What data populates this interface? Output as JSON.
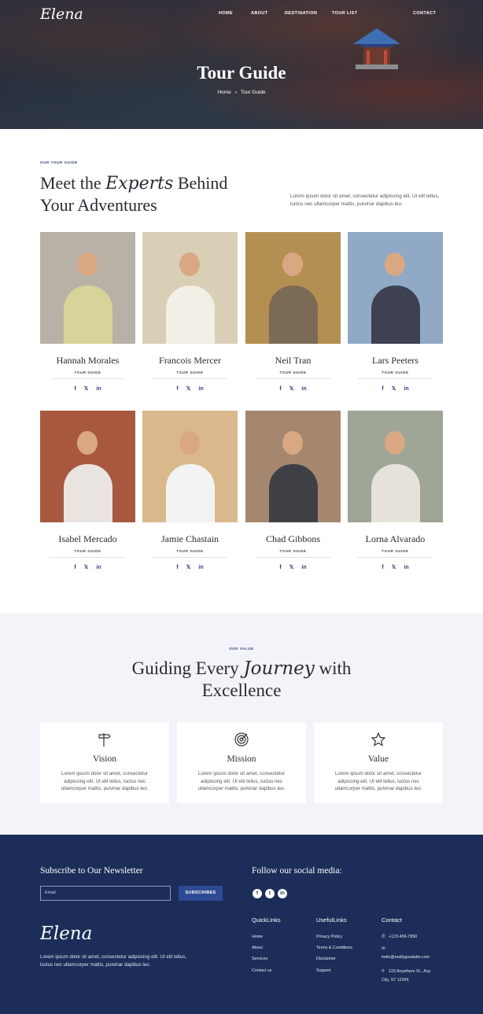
{
  "brand": "Elena",
  "nav": [
    "HOME",
    "ABOUT",
    "DESTINATION",
    "TOUR LIST",
    "CONTACT"
  ],
  "hero": {
    "title": "Tour Guide",
    "breadcrumb_home": "Home",
    "breadcrumb_current": "Tour Guide"
  },
  "team": {
    "eyebrow": "OUR TOUR GUIDE",
    "heading_pre": "Meet the",
    "heading_script": "Experts",
    "heading_post": "Behind",
    "heading_line2": "Your Adventures",
    "intro": "Lorem ipsum dolor sit amet, consectetur adipiscing elit. Ut elit tellus, luctus nec ullamcorper mattis, pulvinar dapibus leo.",
    "role": "TOUR GUIDE",
    "social_icons": [
      "facebook-icon",
      "x-icon",
      "linkedin-icon"
    ],
    "social_glyphs": [
      "f",
      "𝕏",
      "in"
    ],
    "members": [
      {
        "name": "Hannah Morales",
        "bg": "#b8b2a6",
        "shirt": "#d7d49a"
      },
      {
        "name": "Francois Mercer",
        "bg": "#d8cfb6",
        "shirt": "#f1efe6"
      },
      {
        "name": "Neil Tran",
        "bg": "#b48f52",
        "shirt": "#7a6a56"
      },
      {
        "name": "Lars Peeters",
        "bg": "#8fa9c6",
        "shirt": "#3d4152"
      },
      {
        "name": "Isabel Mercado",
        "bg": "#a8583f",
        "shirt": "#e9e4df"
      },
      {
        "name": "Jamie Chastain",
        "bg": "#d9b98c",
        "shirt": "#f3f3f3"
      },
      {
        "name": "Chad Gibbons",
        "bg": "#a4876e",
        "shirt": "#3e4045"
      },
      {
        "name": "Lorna Alvarado",
        "bg": "#9fa597",
        "shirt": "#e7e2d9"
      }
    ]
  },
  "values": {
    "eyebrow": "OUR VALUE",
    "heading_pre": "Guiding Every",
    "heading_script": "Journey",
    "heading_post": "with",
    "heading_line2": "Excellence",
    "cards": [
      {
        "icon": "signpost-icon",
        "title": "Vision",
        "text": "Lorem ipsum dolor sit amet, consectetur adipiscing elit. Ut elit tellus, luctus nec ullamcorper mattis, pulvinar dapibus leo."
      },
      {
        "icon": "target-icon",
        "title": "Mission",
        "text": "Lorem ipsum dolor sit amet, consectetur adipiscing elit. Ut elit tellus, luctus nec ullamcorper mattis, pulvinar dapibus leo."
      },
      {
        "icon": "star-icon",
        "title": "Value",
        "text": "Lorem ipsum dolor sit amet, consectetur adipiscing elit. Ut elit tellus, luctus nec ullamcorper mattis, pulvinar dapibus leo."
      }
    ]
  },
  "footer": {
    "newsletter_title": "Subscribe to Our Newsletter",
    "email_placeholder": "Email",
    "subscribe_label": "SUBSCRIBES",
    "social_title": "Follow our social media:",
    "social_glyphs": [
      "f",
      "t",
      "in"
    ],
    "brand": "Elena",
    "about": "Lorem ipsum dolor sit amet, consectetur adipiscing elit. Ut elit tellus, luctus nec ullamcorper mattis, pulvinar dapibus leo.",
    "quick_links_title": "QuickLinks",
    "quick_links": [
      "Home",
      "About",
      "Services",
      "Contact us"
    ],
    "useful_links_title": "UsefulLinks",
    "useful_links": [
      "Privacy Policy",
      "Terms & Conditions",
      "Disclaimer",
      "Support"
    ],
    "contact_title": "Contact",
    "phone": "+123-456-7890",
    "email": "hello@reallygreatsite.com",
    "address_line1": "123 Anywhere St., Any",
    "address_line2": "City, ST 12345"
  },
  "colors": {
    "navy": "#1b2d58",
    "accent": "#2c3f78",
    "button": "#2d4a94",
    "section_bg": "#f3f4f9"
  }
}
